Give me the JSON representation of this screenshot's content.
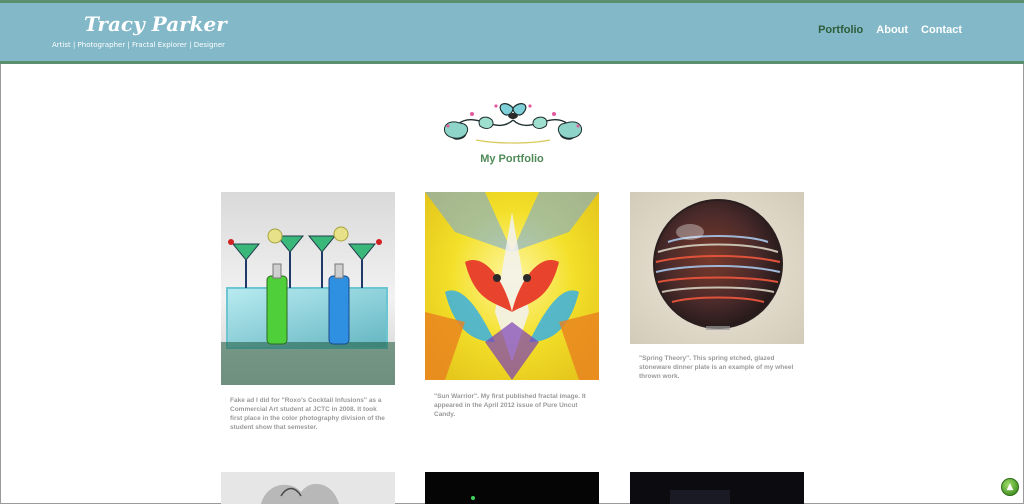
{
  "header": {
    "title": "Tracy Parker",
    "tagline": "Artist | Photographer | Fractal Explorer | Designer",
    "nav": [
      "Portfolio",
      "About",
      "Contact"
    ],
    "active_nav": "Portfolio"
  },
  "portfolio": {
    "title": "My Portfolio",
    "items": [
      {
        "caption": "Fake ad I did for \"Roxo's Cocktail Infusions\" as a Commercial Art student at JCTC in 2008. It took first place in the color photography division of the student show that semester."
      },
      {
        "caption": "\"Sun Warrior\". My first published fractal image. It appeared in the April 2012 issue of Pure Uncut Candy."
      },
      {
        "caption": "\"Spring Theory\". This spring etched, glazed stoneware dinner plate is an example of my wheel thrown work."
      }
    ]
  },
  "colors": {
    "header_bg": "#82b8c8",
    "header_border": "#5b8f6e",
    "active_nav": "#2e5d3a",
    "section_title": "#4f8a57",
    "caption": "#9a9a9a"
  },
  "icons": {
    "ornament": "decorative-scroll-icon",
    "scroll_top": "up-arrow-icon"
  }
}
